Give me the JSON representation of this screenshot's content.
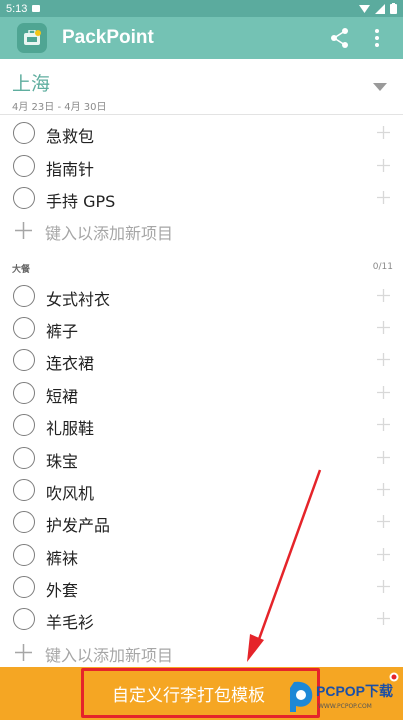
{
  "status_bar": {
    "time": "5:13"
  },
  "app": {
    "title": "PackPoint"
  },
  "trip": {
    "name": "上海",
    "dates": "4月 23日 - 4月 30日"
  },
  "sections": [
    {
      "title": "",
      "count": "",
      "items": [
        {
          "label": "急救包"
        },
        {
          "label": "指南针"
        },
        {
          "label": "手持 GPS"
        }
      ],
      "add_placeholder": "键入以添加新项目"
    },
    {
      "title": "大餐",
      "count": "0/11",
      "items": [
        {
          "label": "女式衬衣"
        },
        {
          "label": "裤子"
        },
        {
          "label": "连衣裙"
        },
        {
          "label": "短裙"
        },
        {
          "label": "礼服鞋"
        },
        {
          "label": "珠宝"
        },
        {
          "label": "吹风机"
        },
        {
          "label": "护发产品"
        },
        {
          "label": "裤袜"
        },
        {
          "label": "外套"
        },
        {
          "label": "羊毛衫"
        }
      ],
      "add_placeholder": "键入以添加新项目"
    }
  ],
  "bottom_bar": {
    "label": "自定义行李打包模板"
  },
  "watermark": {
    "text": "PCPOP下载",
    "subtext": "WWW.PCPOP.COM"
  },
  "colors": {
    "appbar": "#74c2b4",
    "accent": "#5fae9f",
    "bottom_bar": "#f5a623",
    "annotation": "#e5242a"
  }
}
